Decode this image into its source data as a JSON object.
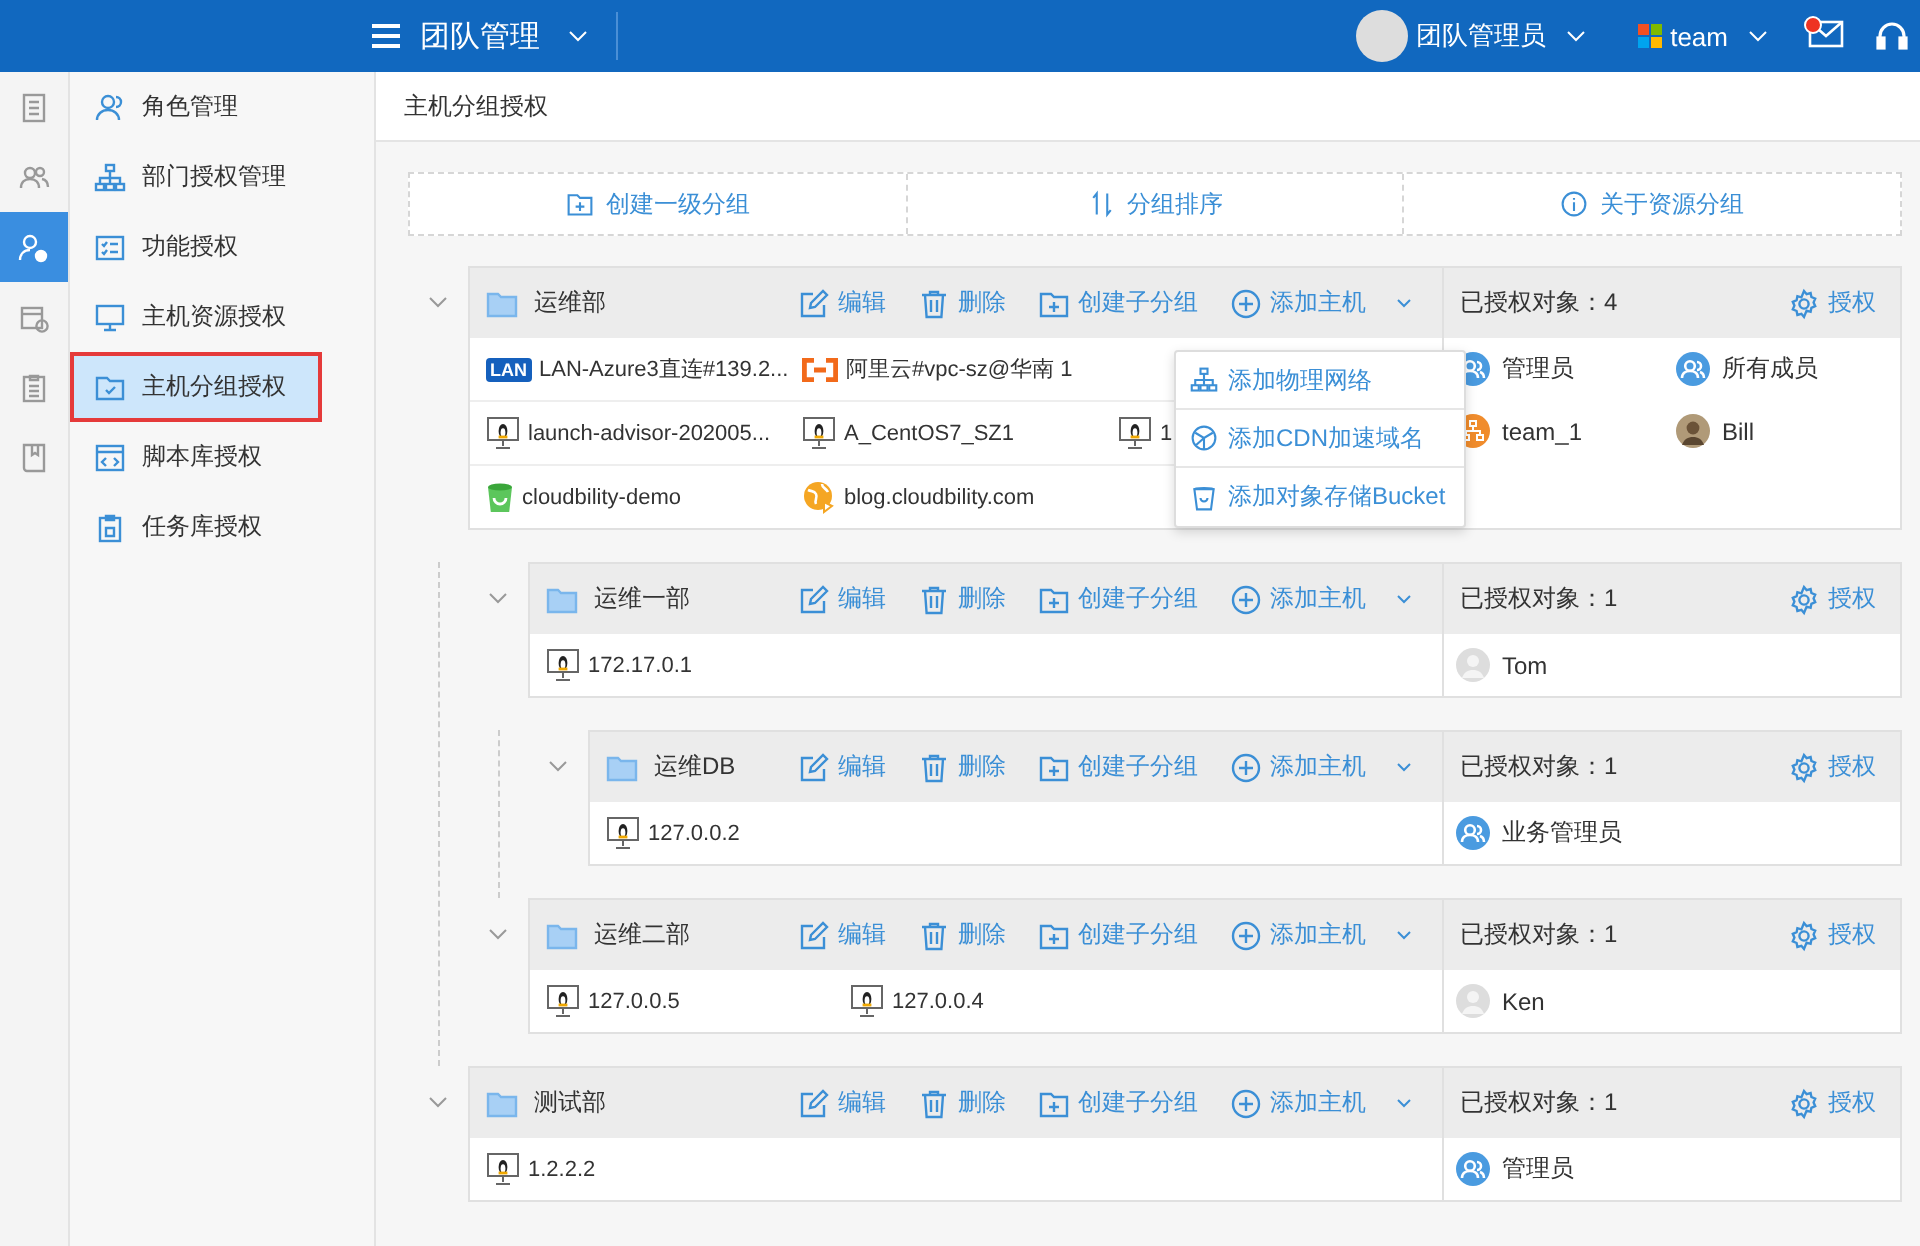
{
  "topbar": {
    "title": "团队管理",
    "user": "团队管理员",
    "team": "team",
    "has_unread": true
  },
  "rail": [
    {
      "selected": false
    },
    {
      "selected": false
    },
    {
      "selected": true
    },
    {
      "selected": false
    },
    {
      "selected": false
    },
    {
      "selected": false
    }
  ],
  "nav": [
    {
      "label": "角色管理",
      "selected": false,
      "highlighted": false
    },
    {
      "label": "部门授权管理",
      "selected": false,
      "highlighted": false
    },
    {
      "label": "功能授权",
      "selected": false,
      "highlighted": false
    },
    {
      "label": "主机资源授权",
      "selected": false,
      "highlighted": false
    },
    {
      "label": "主机分组授权",
      "selected": true,
      "highlighted": true
    },
    {
      "label": "脚本库授权",
      "selected": false,
      "highlighted": false
    },
    {
      "label": "任务库授权",
      "selected": false,
      "highlighted": false
    }
  ],
  "page_title": "主机分组授权",
  "toolbar": [
    "创建一级分组",
    "分组排序",
    "关于资源分组"
  ],
  "groups": [
    {
      "name": "运维部",
      "expanded": true,
      "actions": [
        "编辑",
        "删除",
        "创建子分组",
        "添加主机"
      ],
      "authorized": "已授权对象：4",
      "grant": "授权",
      "host_rows": [
        [
          {
            "kind": "lan",
            "icon_text": "LAN",
            "label": "LAN-Azure3直连#139.2..."
          },
          {
            "kind": "aliyun",
            "label": "阿里云#vpc-sz@华南 1"
          }
        ],
        [
          {
            "kind": "linux",
            "label": "launch-advisor-202005..."
          },
          {
            "kind": "linux",
            "label": "A_CentOS7_SZ1"
          },
          {
            "kind": "linux",
            "label": "1"
          }
        ],
        [
          {
            "kind": "bucket",
            "label": "cloudbility-demo"
          },
          {
            "kind": "cdn",
            "label": "blog.cloudbility.com"
          }
        ]
      ],
      "grantees": [
        {
          "kind": "role",
          "name": "管理员"
        },
        {
          "kind": "role",
          "name": "所有成员"
        },
        {
          "kind": "team",
          "name": "team_1"
        },
        {
          "kind": "photo",
          "name": "Bill"
        }
      ],
      "menu": [
        "添加物理网络",
        "添加CDN加速域名",
        "添加对象存储Bucket"
      ],
      "children": [
        {
          "name": "运维一部",
          "expanded": true,
          "actions": [
            "编辑",
            "删除",
            "创建子分组",
            "添加主机"
          ],
          "authorized": "已授权对象：1",
          "grant": "授权",
          "host_rows": [
            [
              {
                "kind": "linux",
                "label": "172.17.0.1"
              }
            ]
          ],
          "grantees": [
            {
              "kind": "user",
              "name": "Tom"
            }
          ],
          "children": [
            {
              "name": "运维DB",
              "expanded": true,
              "actions": [
                "编辑",
                "删除",
                "创建子分组",
                "添加主机"
              ],
              "authorized": "已授权对象：1",
              "grant": "授权",
              "host_rows": [
                [
                  {
                    "kind": "linux",
                    "label": "127.0.0.2"
                  }
                ]
              ],
              "grantees": [
                {
                  "kind": "role",
                  "name": "业务管理员"
                }
              ]
            }
          ]
        },
        {
          "name": "运维二部",
          "expanded": true,
          "actions": [
            "编辑",
            "删除",
            "创建子分组",
            "添加主机"
          ],
          "authorized": "已授权对象：1",
          "grant": "授权",
          "host_rows": [
            [
              {
                "kind": "linux",
                "label": "127.0.0.5"
              },
              {
                "kind": "linux",
                "label": "127.0.0.4"
              }
            ]
          ],
          "grantees": [
            {
              "kind": "user",
              "name": "Ken"
            }
          ]
        }
      ]
    },
    {
      "name": "测试部",
      "expanded": true,
      "actions": [
        "编辑",
        "删除",
        "创建子分组",
        "添加主机"
      ],
      "authorized": "已授权对象：1",
      "grant": "授权",
      "host_rows": [
        [
          {
            "kind": "linux",
            "label": "1.2.2.2"
          }
        ]
      ],
      "grantees": [
        {
          "kind": "role",
          "name": "管理员"
        }
      ]
    }
  ]
}
